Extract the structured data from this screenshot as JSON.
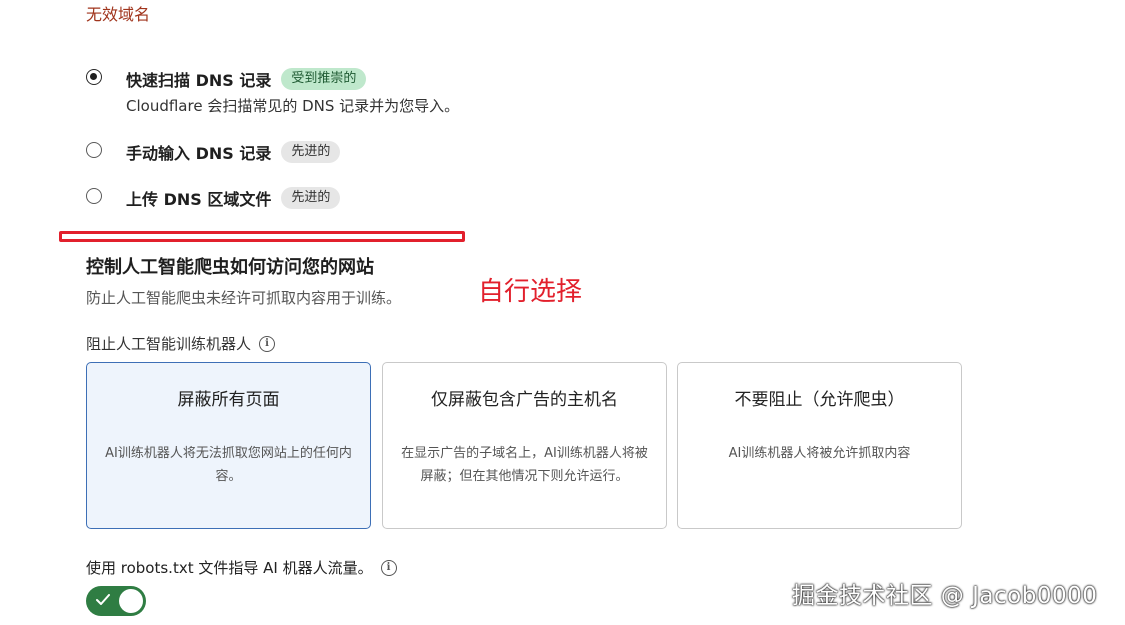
{
  "error": {
    "text": "无效域名"
  },
  "import_options": [
    {
      "label": "快速扫描 DNS 记录",
      "badge": "受到推崇的",
      "desc": "Cloudflare 会扫描常见的 DNS 记录并为您导入。",
      "checked": true
    },
    {
      "label": "手动输入 DNS 记录",
      "badge": "先进的",
      "checked": false
    },
    {
      "label": "上传 DNS 区域文件",
      "badge": "先进的",
      "checked": false
    }
  ],
  "ai_section": {
    "title": "控制人工智能爬虫如何访问您的网站",
    "desc": "防止人工智能爬虫未经许可抓取内容用于训练。",
    "annotation": "自行选择",
    "field_label": "阻止人工智能训练机器人",
    "cards": [
      {
        "title": "屏蔽所有页面",
        "desc": "AI训练机器人将无法抓取您网站上的任何内容。",
        "selected": true
      },
      {
        "title": "仅屏蔽包含广告的主机名",
        "desc": "在显示广告的子域名上，AI训练机器人将被屏蔽；但在其他情况下则允许运行。",
        "selected": false
      },
      {
        "title": "不要阻止（允许爬虫）",
        "desc": "AI训练机器人将被允许抓取内容",
        "selected": false
      }
    ]
  },
  "robots": {
    "label": "使用 robots.txt 文件指导 AI 机器人流量。",
    "enabled": true
  },
  "info_icon": {
    "glyph": "i"
  },
  "watermark": {
    "text": "掘金技术社区 @ Jacob0000"
  },
  "colors": {
    "toggle_on": "#2f7d43",
    "selected_card": "#eef4fc",
    "annotation": "#e2202c"
  }
}
